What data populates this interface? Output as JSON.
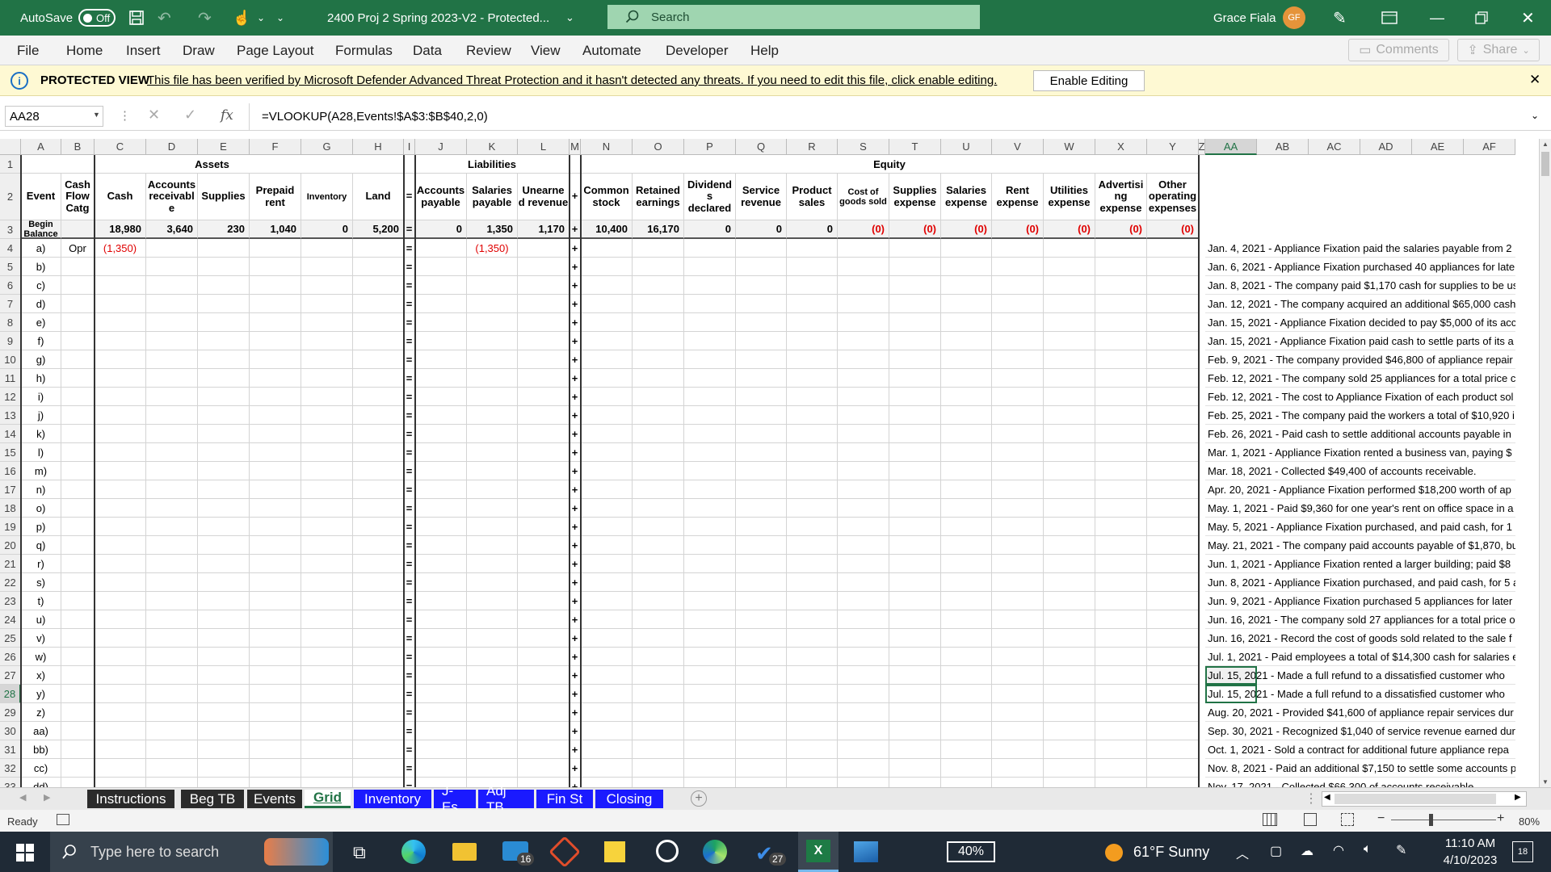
{
  "title": {
    "autosave": "AutoSave",
    "toggle": "Off",
    "doc": "2400 Proj 2 Spring 2023-V2  -  Protected...",
    "search": "Search",
    "user": "Grace Fiala",
    "initials": "GF"
  },
  "menu": [
    "File",
    "Home",
    "Insert",
    "Draw",
    "Page Layout",
    "Formulas",
    "Data",
    "Review",
    "View",
    "Automate",
    "Developer",
    "Help"
  ],
  "comments": "Comments",
  "share": "Share",
  "pv": {
    "label": "PROTECTED VIEW",
    "msg": "This file has been verified by Microsoft Defender Advanced Threat Protection and it hasn't detected any threats. If you need to edit this file, click enable editing.",
    "btn": "Enable Editing"
  },
  "formula": {
    "name": "AA28",
    "fx": "fx",
    "text": "=VLOOKUP(A28,Events!$A$3:$B$40,2,0)"
  },
  "cols": [
    "A",
    "B",
    "C",
    "D",
    "E",
    "F",
    "G",
    "H",
    "I",
    "J",
    "K",
    "L",
    "M",
    "N",
    "O",
    "P",
    "Q",
    "R",
    "S",
    "T",
    "U",
    "V",
    "W",
    "X",
    "Y",
    "Z",
    "AA",
    "AB",
    "AC",
    "AD",
    "AE",
    "AF"
  ],
  "groups": {
    "assets": "Assets",
    "liab": "Liabilities",
    "equity": "Equity"
  },
  "hdrs": {
    "a": "Event",
    "b": "Cash Flow Catg",
    "c": "Cash",
    "d": "Accounts receivabl e",
    "e": "Supplies",
    "f": "Prepaid rent",
    "g": "Inventory",
    "h": "Land",
    "i": "=",
    "j": "Accounts payable",
    "k": "Salaries payable",
    "l": "Unearne d revenue",
    "m": "+",
    "n": "Common stock",
    "o": "Retained earnings",
    "p": "Dividend s declared",
    "q": "Service revenue",
    "r": "Product sales",
    "s": "Cost of goods sold",
    "t": "Supplies expense",
    "u": "Salaries expense",
    "v": "Rent expense",
    "w": "Utilities expense",
    "x": "Advertisi ng expense",
    "y": "Other operating expenses"
  },
  "begin": {
    "a": "Begin Balance",
    "c": "18,980",
    "d": "3,640",
    "e": "230",
    "f": "1,040",
    "g": "0",
    "h": "5,200",
    "i": "=",
    "j": "0",
    "k": "1,350",
    "l": "1,170",
    "m": "+",
    "n": "10,400",
    "o": "16,170",
    "p": "0",
    "q": "0",
    "r": "0",
    "s": "(0)",
    "t": "(0)",
    "u": "(0)",
    "v": "(0)",
    "w": "(0)",
    "x": "(0)",
    "y": "(0)"
  },
  "row4": {
    "b": "Opr",
    "c": "(1,350)",
    "k": "(1,350)"
  },
  "events": [
    "a)",
    "b)",
    "c)",
    "d)",
    "e)",
    "f)",
    "g)",
    "h)",
    "i)",
    "j)",
    "k)",
    "l)",
    "m)",
    "n)",
    "o)",
    "p)",
    "q)",
    "r)",
    "s)",
    "t)",
    "u)",
    "v)",
    "w)",
    "x)",
    "y)",
    "z)",
    "aa)",
    "bb)",
    "cc)",
    "dd)"
  ],
  "desc": [
    "Jan. 4, 2021 - Appliance Fixation paid the salaries payable from 2",
    "Jan. 6, 2021 - Appliance Fixation purchased 40 appliances for late",
    "Jan. 8, 2021 - The company paid $1,170 cash for supplies to be us",
    "Jan. 12, 2021 - The company acquired an additional $65,000 cash",
    "Jan. 15, 2021 - Appliance Fixation decided to pay $5,000 of its acc",
    "Jan. 15, 2021 - Appliance Fixation paid cash to settle parts of its a",
    "Feb. 9, 2021 - The company provided $46,800 of appliance repair",
    "Feb. 12, 2021 - The company sold 25 appliances for a total price c",
    "Feb. 12, 2021 - The cost to Appliance Fixation of each product sol",
    "Feb. 25, 2021 - The company paid the workers a total of $10,920 i",
    "Feb. 26, 2021 - Paid cash to settle additional accounts payable in",
    "Mar. 1, 2021 - Appliance Fixation rented a business van, paying $",
    "Mar. 18, 2021 - Collected $49,400 of accounts receivable.",
    "Apr. 20, 2021 - Appliance Fixation performed $18,200 worth of ap",
    "May. 1, 2021 - Paid $9,360 for one year's rent on office space in a",
    "May. 5, 2021 - Appliance Fixation purchased, and paid cash, for 1",
    "May. 21, 2021 - The company paid accounts payable of $1,870, bu",
    "Jun. 1, 2021 - Appliance Fixation rented a larger building; paid $8",
    "Jun. 8, 2021 - Appliance Fixation purchased, and paid cash, for 5 a",
    "Jun. 9, 2021 - Appliance Fixation purchased 5 appliances for later",
    "Jun. 16, 2021 - The company sold 27 appliances for a total price o",
    "Jun. 16, 2021 - Record the cost of goods sold related to the sale f",
    "Jul. 1, 2021 - Paid employees a total of $14,300 cash for salaries e",
    "Jul. 15, 2021 - Made a full refund to a dissatisfied customer who",
    "Jul. 15, 2021 - Made a full refund to a dissatisfied customer who",
    "Aug. 20, 2021 - Provided $41,600 of appliance repair services dur",
    "Sep. 30, 2021 - Recognized $1,040 of service revenue earned dur",
    "Oct. 1, 2021 - Sold a contract for additional future appliance repa",
    "Nov. 8, 2021 - Paid an additional $7,150 to settle some accounts p",
    "Nov. 17, 2021 - Collected $66,300 of accounts receivable"
  ],
  "sheets": [
    "Instructions",
    "Beg TB",
    "Events",
    "Grid",
    "Inventory",
    "J-Es",
    "Adj TB",
    "Fin St",
    "Closing"
  ],
  "status": {
    "ready": "Ready",
    "zoom": "80%"
  },
  "taskbar": {
    "search": "Type here to search",
    "mail_badge": "16",
    "todo_badge": "27",
    "battery": "40%",
    "weather": "61°F  Sunny",
    "time": "11:10 AM",
    "date": "4/10/2023",
    "notif": "18"
  },
  "colors": {
    "excel_green": "#217346",
    "red": "#e00000",
    "sheet_blue": "#1a1aff"
  }
}
